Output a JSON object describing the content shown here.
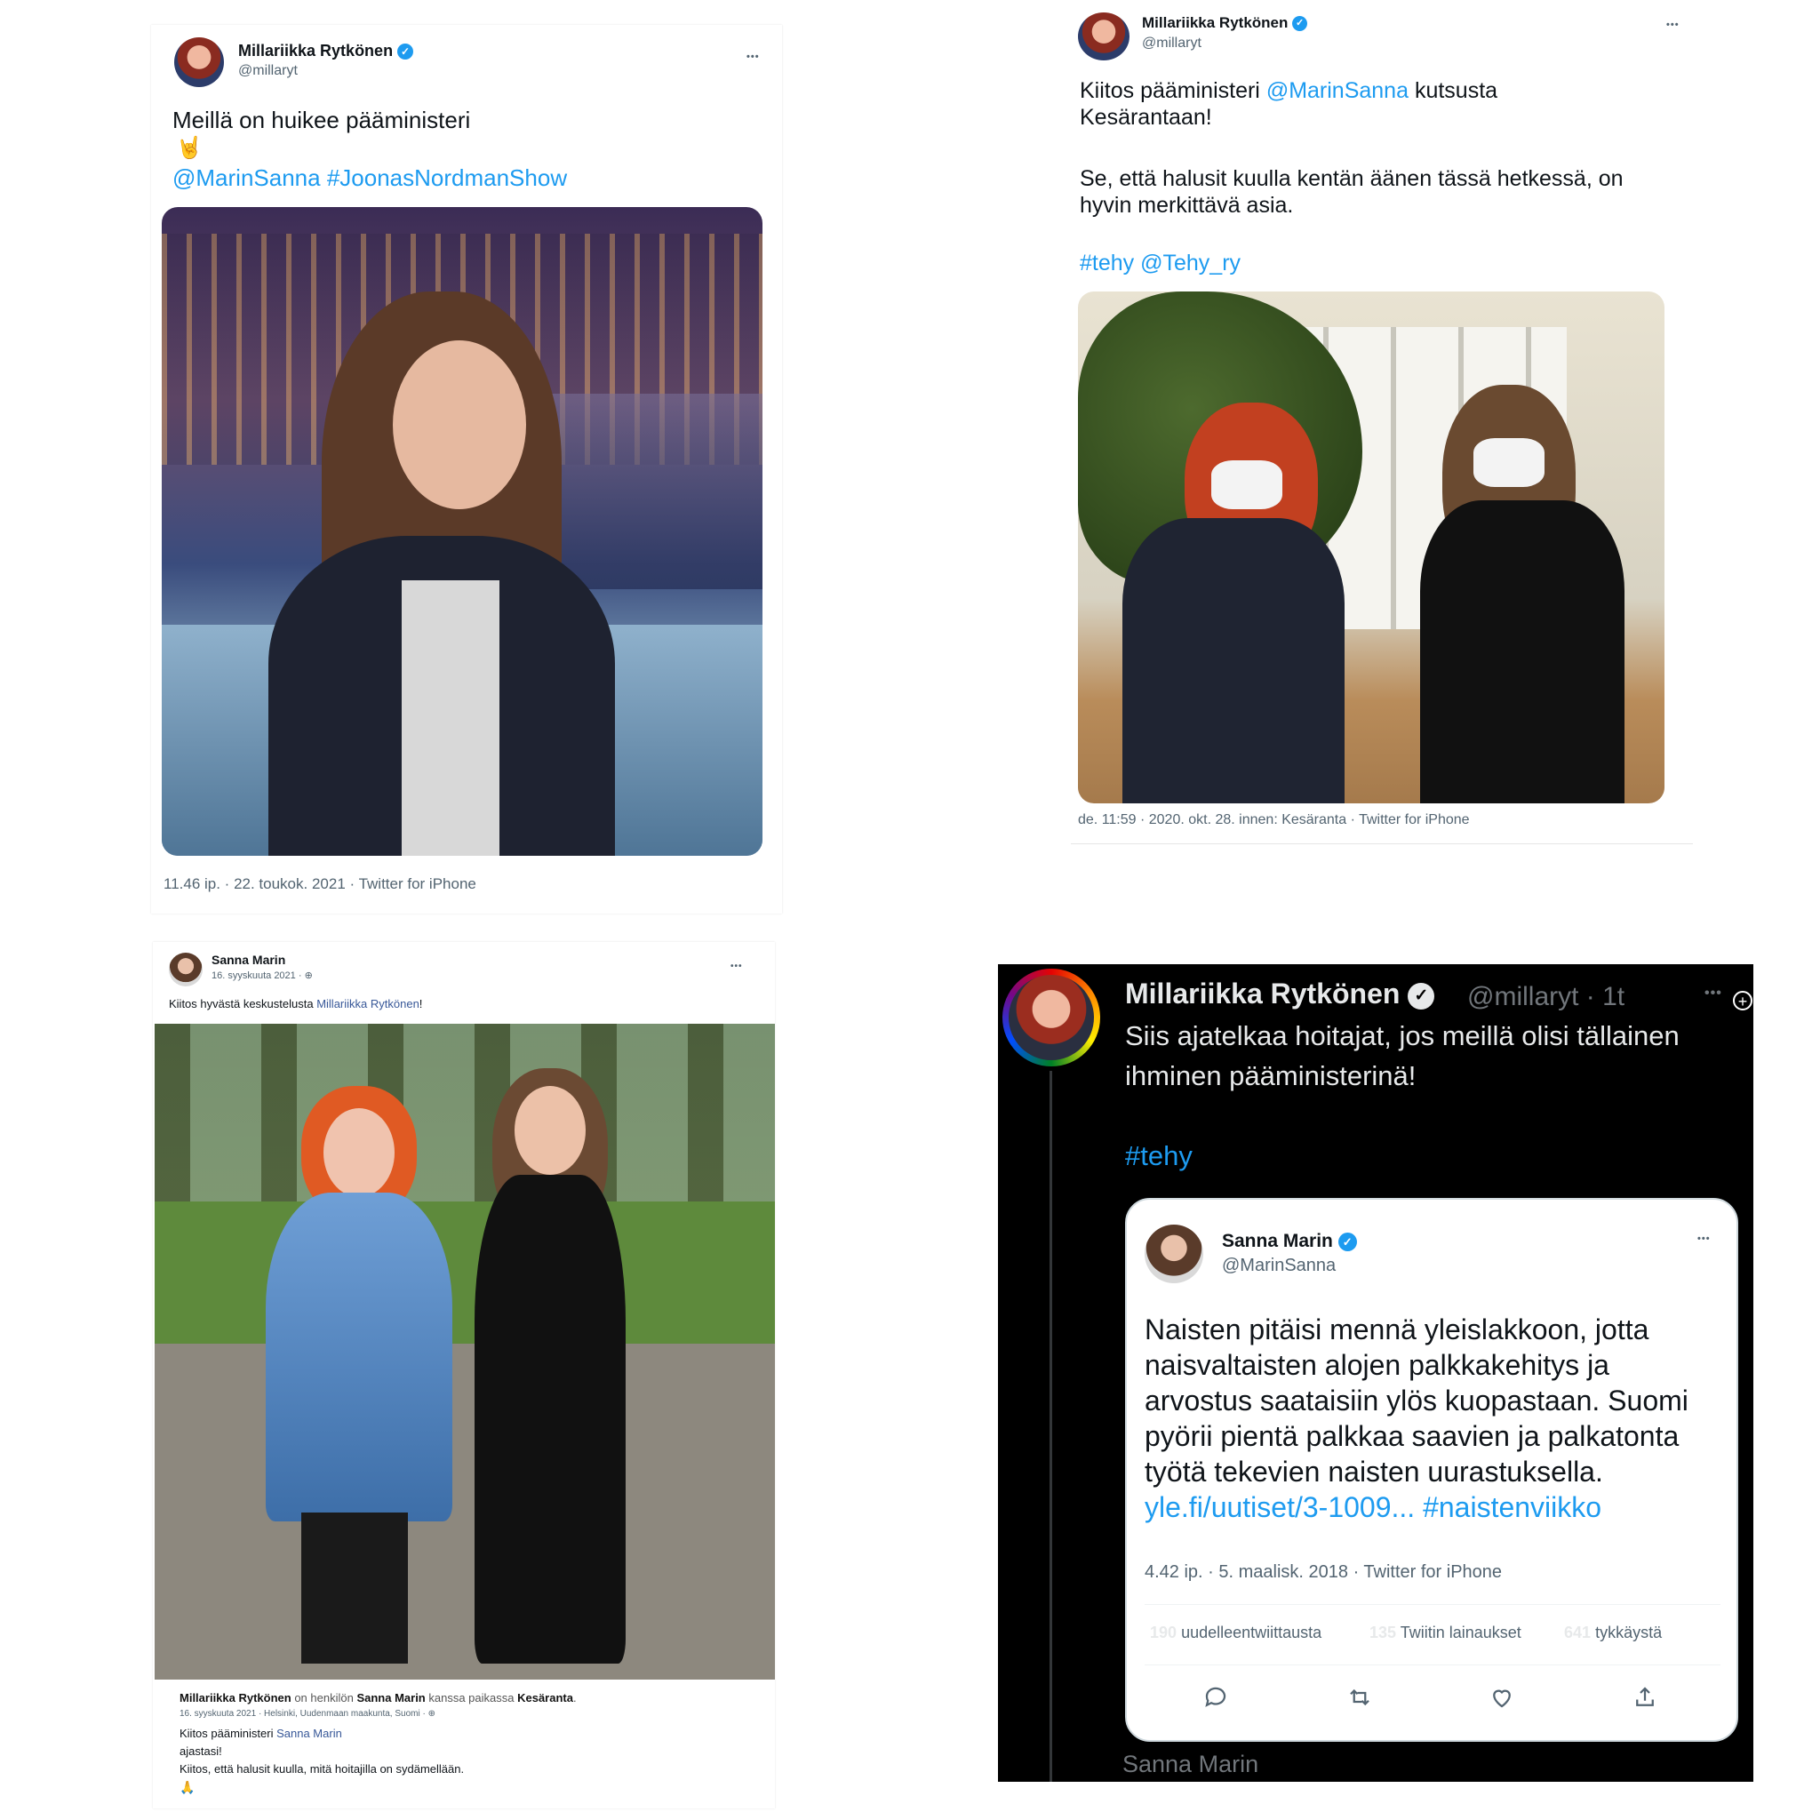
{
  "colors": {
    "twitter_blue": "#1d9bf0",
    "fb_blue": "#385898",
    "gray": "#536471",
    "black": "#000000"
  },
  "tweet1": {
    "name": "Millariikka Rytkönen",
    "handle": "@millaryt",
    "more": "•••",
    "line1": "Meillä on huikee pääministeri",
    "emoji": "🤘",
    "mention": "@MarinSanna",
    "hashtag": "#JoonasNordmanShow",
    "meta": "11.46 ip. · 22. toukok. 2021 · Twitter for iPhone"
  },
  "tweet2": {
    "name": "Millariikka Rytkönen",
    "handle": "@millaryt",
    "more": "•••",
    "line1_a": "Kiitos pääministeri ",
    "line1_mention": "@MarinSanna",
    "line1_b": " kutsusta",
    "line2": "Kesärantaan!",
    "line3": "Se, että halusit kuulla kentän äänen tässä hetkessä, on",
    "line4": "hyvin merkittävä asia.",
    "tags": "#tehy @Tehy_ry",
    "meta": "de. 11:59 · 2020. okt. 28. innen: Kesäranta · Twitter for iPhone"
  },
  "fbpost": {
    "name": "Sanna Marin",
    "date": "16. syyskuuta 2021 · ",
    "more": "•••",
    "text_a": "Kiitos hyvästä keskustelusta ",
    "text_link": "Millariikka Rytkönen",
    "text_b": "!",
    "shared_name": "Millariikka Rytkönen",
    "shared_mid": " on henkilön ",
    "shared_name2": "Sanna Marin",
    "shared_mid2": " kanssa paikassa ",
    "shared_place": "Kesäranta",
    "shared_end": ".",
    "shared_date": "16. syyskuuta 2021 · Helsinki, Uudenmaan maakunta, Suomi · ",
    "shared_line1_a": "Kiitos pääministeri ",
    "shared_line1_link": "Sanna Marin",
    "shared_line2": "ajastasi!",
    "shared_line3": "Kiitos, että halusit kuulla, mitä hoitajilla on sydämellään.",
    "shared_emoji": "🙏"
  },
  "tweet4": {
    "name": "Millariikka Rytkönen",
    "handle": "@millaryt · 1t",
    "more": "•••",
    "line1": "Siis ajatelkaa hoitajat, jos meillä olisi tällainen",
    "line2": "ihminen pääministerinä!",
    "tag": "#tehy",
    "footer": "Sanna Marin",
    "quoted": {
      "name": "Sanna Marin",
      "handle": "@MarinSanna",
      "more": "•••",
      "l1": "Naisten pitäisi mennä yleislakkoon, jotta",
      "l2": "naisvaltaisten alojen palkkakehitys ja",
      "l3": "arvostus saataisiin ylös kuopastaan. Suomi",
      "l4": "pyörii pientä palkkaa saavien ja palkatonta",
      "l5": "työtä tekevien naisten uurastuksella.",
      "link": "yle.fi/uutiset/3-1009...",
      "hashtag": "#naistenviikko",
      "meta": "4.42 ip. · 5. maalisk. 2018 · Twitter for iPhone",
      "retweets_n": "190",
      "retweets_l": "uudelleentwiittausta",
      "quotes_n": "135",
      "quotes_l": "Twiitin lainaukset",
      "likes_n": "641",
      "likes_l": "tykkäystä"
    }
  }
}
